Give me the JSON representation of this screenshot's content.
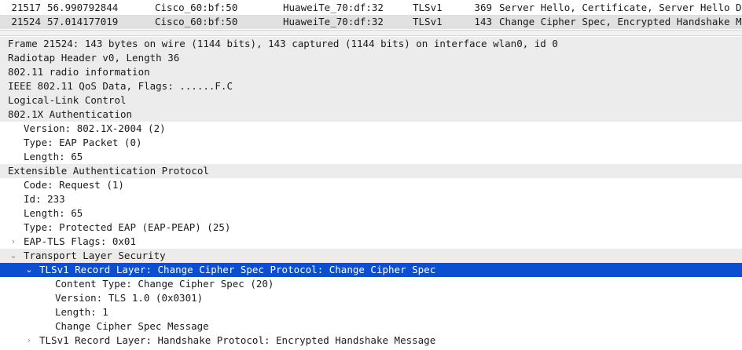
{
  "packet_list": {
    "rows": [
      {
        "no": "21517",
        "time": "56.990792844",
        "source": "Cisco_60:bf:50",
        "destination": "HuaweiTe_70:df:32",
        "protocol": "TLSv1",
        "length": "369",
        "info": "Server Hello, Certificate, Server Hello Done"
      },
      {
        "no": "21524",
        "time": "57.014177019",
        "source": "Cisco_60:bf:50",
        "destination": "HuaweiTe_70:df:32",
        "protocol": "TLSv1",
        "length": "143",
        "info": "Change Cipher Spec, Encrypted Handshake Message"
      }
    ]
  },
  "details": {
    "rows": [
      {
        "text": "Frame 21524: 143 bytes on wire (1144 bits), 143 captured (1144 bits) on interface wlan0, id 0",
        "level": 0,
        "arrow": "",
        "shade": true
      },
      {
        "text": "Radiotap Header v0, Length 36",
        "level": 0,
        "arrow": "",
        "shade": true
      },
      {
        "text": "802.11 radio information",
        "level": 0,
        "arrow": "",
        "shade": true
      },
      {
        "text": "IEEE 802.11 QoS Data, Flags: ......F.C",
        "level": 0,
        "arrow": "",
        "shade": true
      },
      {
        "text": "Logical-Link Control",
        "level": 0,
        "arrow": "",
        "shade": true
      },
      {
        "text": "802.1X Authentication",
        "level": 0,
        "arrow": "",
        "shade": true
      },
      {
        "text": "Version: 802.1X-2004 (2)",
        "level": 1,
        "arrow": "",
        "shade": false
      },
      {
        "text": "Type: EAP Packet (0)",
        "level": 1,
        "arrow": "",
        "shade": false
      },
      {
        "text": "Length: 65",
        "level": 1,
        "arrow": "",
        "shade": false
      },
      {
        "text": "Extensible Authentication Protocol",
        "level": 0,
        "arrow": "",
        "shade": true
      },
      {
        "text": "Code: Request (1)",
        "level": 1,
        "arrow": "",
        "shade": false
      },
      {
        "text": "Id: 233",
        "level": 1,
        "arrow": "",
        "shade": false
      },
      {
        "text": "Length: 65",
        "level": 1,
        "arrow": "",
        "shade": false
      },
      {
        "text": "Type: Protected EAP (EAP-PEAP) (25)",
        "level": 1,
        "arrow": "",
        "shade": false
      },
      {
        "text": "EAP-TLS Flags: 0x01",
        "level": 1,
        "arrow": "›",
        "shade": false
      },
      {
        "text": "Transport Layer Security",
        "level": 1,
        "arrow": "⌄",
        "shade": true
      },
      {
        "text": "TLSv1 Record Layer: Change Cipher Spec Protocol: Change Cipher Spec",
        "level": 2,
        "arrow": "⌄",
        "shade": false,
        "selected": true
      },
      {
        "text": "Content Type: Change Cipher Spec (20)",
        "level": 3,
        "arrow": "",
        "shade": false
      },
      {
        "text": "Version: TLS 1.0 (0x0301)",
        "level": 3,
        "arrow": "",
        "shade": false
      },
      {
        "text": "Length: 1",
        "level": 3,
        "arrow": "",
        "shade": false
      },
      {
        "text": "Change Cipher Spec Message",
        "level": 3,
        "arrow": "",
        "shade": false
      },
      {
        "text": "TLSv1 Record Layer: Handshake Protocol: Encrypted Handshake Message",
        "level": 2,
        "arrow": "›",
        "shade": false
      }
    ]
  },
  "colors": {
    "selected_bg": "#0b4ed2",
    "section_bg": "#ececec",
    "packet_row_selected_bg": "#e1e1e1"
  }
}
